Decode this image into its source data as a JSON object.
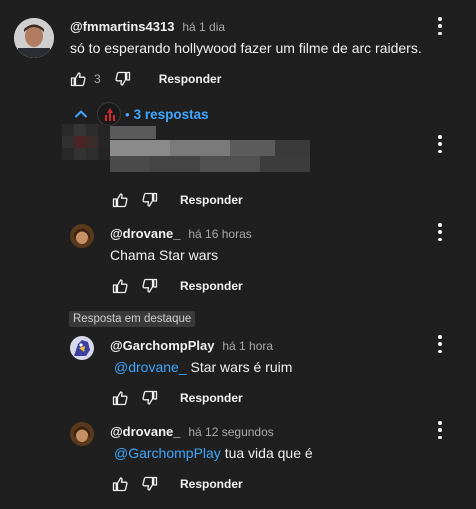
{
  "top_comment": {
    "handle": "@fmmartins4313",
    "time": "há 1 dia",
    "text": "só to esperando hollywood fazer um filme de arc raiders.",
    "like_count": "3",
    "reply_label": "Responder"
  },
  "replies_toggle": {
    "separator": "•",
    "label": "3 respostas"
  },
  "replies": [
    {
      "handle": "",
      "time": "",
      "text": "",
      "reply_label": "Responder"
    },
    {
      "handle": "@drovane_",
      "time": "há 16 horas",
      "text": "Chama Star wars",
      "reply_label": "Responder"
    },
    {
      "badge": "Resposta em destaque",
      "handle": "@GarchompPlay",
      "time": "há 1 hora",
      "mention": "@drovane_",
      "text": " Star wars é ruim",
      "reply_label": "Responder"
    },
    {
      "handle": "@drovane_",
      "time": "há 12 segundos",
      "mention": "@GarchompPlay",
      "text": " tua vida que é",
      "reply_label": "Responder"
    }
  ],
  "colors": {
    "background": "#1f1f1f",
    "text": "#f1f1f1",
    "muted": "#aaaaaa",
    "link": "#3ea6ff",
    "badge_bg": "#3a3a3a"
  },
  "icons": [
    "thumbs-up-icon",
    "thumbs-down-icon",
    "more-vert-icon",
    "chevron-up-icon"
  ]
}
